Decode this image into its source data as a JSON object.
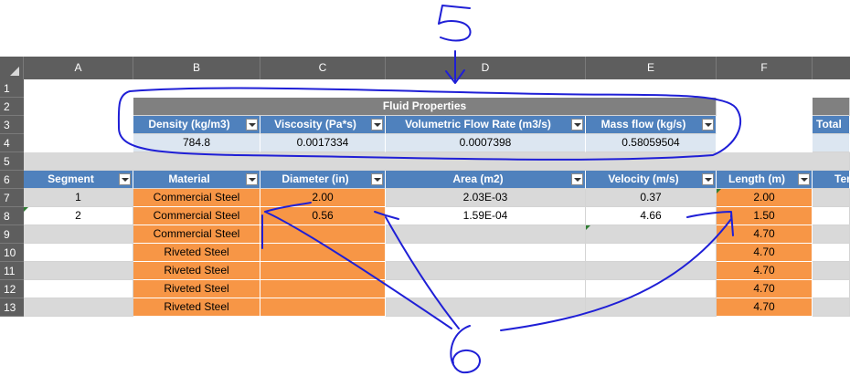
{
  "columns": [
    "A",
    "B",
    "C",
    "D",
    "E",
    "F"
  ],
  "rows": [
    "1",
    "2",
    "3",
    "4",
    "5",
    "6",
    "7",
    "8",
    "9",
    "10",
    "11",
    "12",
    "13"
  ],
  "fluid_properties": {
    "title": "Fluid Properties",
    "headers": [
      "Density (kg/m3)",
      "Viscosity (Pa*s)",
      "Volumetric Flow Rate (m3/s)",
      "Mass flow (kg/s)"
    ],
    "values": [
      "784.8",
      "0.0017334",
      "0.0007398",
      "0.58059504"
    ]
  },
  "right_partial": {
    "header": "Total"
  },
  "segment_table": {
    "headers": [
      "Segment",
      "Material",
      "Diameter (in)",
      "Area (m2)",
      "Velocity (m/s)",
      "Length (m)",
      "Tem"
    ],
    "rows": [
      {
        "segment": "1",
        "material": "Commercial Steel",
        "diameter": "2.00",
        "area": "2.03E-03",
        "velocity": "0.37",
        "length": "2.00"
      },
      {
        "segment": "2",
        "material": "Commercial Steel",
        "diameter": "0.56",
        "area": "1.59E-04",
        "velocity": "4.66",
        "length": "1.50"
      },
      {
        "segment": "",
        "material": "Commercial Steel",
        "diameter": "",
        "area": "",
        "velocity": "",
        "length": "4.70"
      },
      {
        "segment": "",
        "material": "Riveted Steel",
        "diameter": "",
        "area": "",
        "velocity": "",
        "length": "4.70"
      },
      {
        "segment": "",
        "material": "Riveted Steel",
        "diameter": "",
        "area": "",
        "velocity": "",
        "length": "4.70"
      },
      {
        "segment": "",
        "material": "Riveted Steel",
        "diameter": "",
        "area": "",
        "velocity": "",
        "length": "4.70"
      },
      {
        "segment": "",
        "material": "Riveted Steel",
        "diameter": "",
        "area": "",
        "velocity": "",
        "length": "4.70"
      }
    ]
  },
  "annotations": {
    "top_number": "5",
    "bottom_number": "6"
  },
  "colors": {
    "header_blue": "#4f81bd",
    "orange": "#f79646",
    "light_blue": "#dce6f1",
    "gray": "#d9d9d9",
    "ink": "#1f1fd6"
  }
}
